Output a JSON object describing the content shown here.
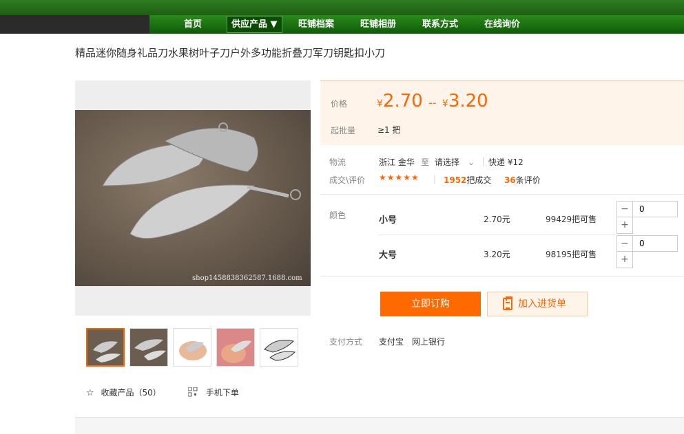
{
  "nav": {
    "items": [
      "首页",
      "供应产品 ▼",
      "旺铺档案",
      "旺铺相册",
      "联系方式",
      "在线询价"
    ]
  },
  "product": {
    "title": "精品迷你随身礼品刀水果树叶子刀户外多功能折叠刀军刀钥匙扣小刀",
    "watermark": "shop1458838362587.1688.com"
  },
  "price": {
    "label": "价格",
    "currency": "¥",
    "low": "2.70",
    "separator": "--",
    "high": "3.20",
    "moq_label": "起批量",
    "moq_value": "≥1 把"
  },
  "logistics": {
    "label": "物流",
    "from": "浙江 金华",
    "to_word": "至",
    "dest": "请选择",
    "shipping": "快递 ¥12"
  },
  "deals": {
    "label": "成交\\评价",
    "stars": "★★★★★",
    "count": "1952",
    "count_suffix": "把成交",
    "reviews": "36",
    "reviews_suffix": "条评价",
    "divider": "|"
  },
  "color": {
    "label": "颜色",
    "skus": [
      {
        "name": "小号",
        "price": "2.70元",
        "stock": "99429把可售",
        "qty": "0"
      },
      {
        "name": "大号",
        "price": "3.20元",
        "stock": "98195把可售",
        "qty": "0"
      }
    ],
    "minus": "−",
    "plus": "+"
  },
  "actions": {
    "buy": "立即订购",
    "cart": "加入进货单"
  },
  "payment": {
    "label": "支付方式",
    "methods": "支付宝　网上银行"
  },
  "bottom": {
    "fav": "收藏产品（50）",
    "mobile": "手机下单"
  },
  "colors": {
    "accent": "#ff6a00",
    "nav_green": "#1e6e12",
    "price_bg": "#fff4ea"
  }
}
